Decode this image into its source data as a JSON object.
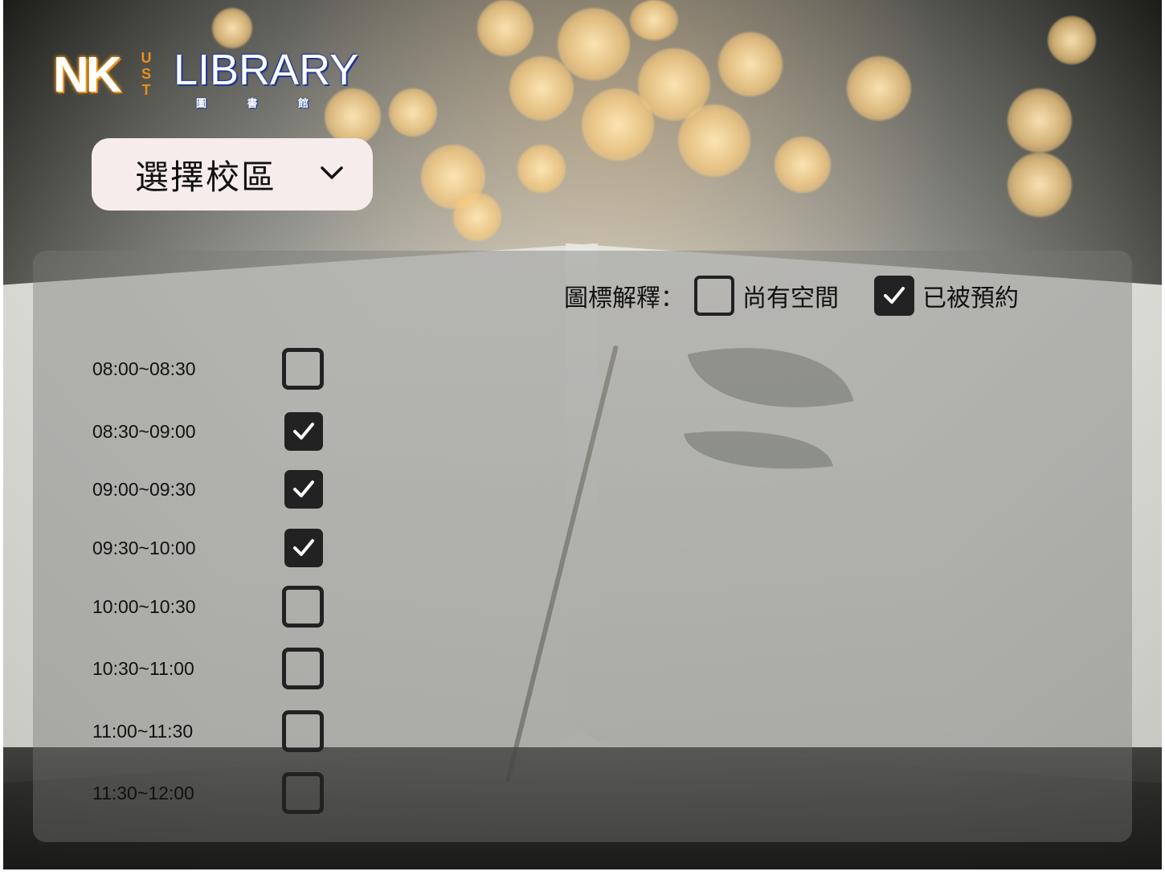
{
  "logo": {
    "nk": "NK",
    "ust": [
      "U",
      "S",
      "T"
    ],
    "library": "LIBRARY",
    "sub": [
      "圖",
      "書",
      "館"
    ]
  },
  "campus_select": {
    "label": "選擇校區",
    "icon": "chevron-down-icon"
  },
  "legend": {
    "title": "圖標解釋：",
    "available": "尚有空間",
    "booked": "已被預約"
  },
  "time_slots": [
    {
      "label": "08:00~08:30",
      "booked": false
    },
    {
      "label": "08:30~09:00",
      "booked": true
    },
    {
      "label": "09:00~09:30",
      "booked": true
    },
    {
      "label": "09:30~10:00",
      "booked": true
    },
    {
      "label": "10:00~10:30",
      "booked": false
    },
    {
      "label": "10:30~11:00",
      "booked": false
    },
    {
      "label": "11:00~11:30",
      "booked": false
    },
    {
      "label": "11:30~12:00",
      "booked": false
    }
  ],
  "colors": {
    "panel": "#787878",
    "checkbox": "#222222",
    "select_bg": "#f6ecec",
    "logo_orange": "#e8901a",
    "logo_blue": "#1d3596"
  }
}
